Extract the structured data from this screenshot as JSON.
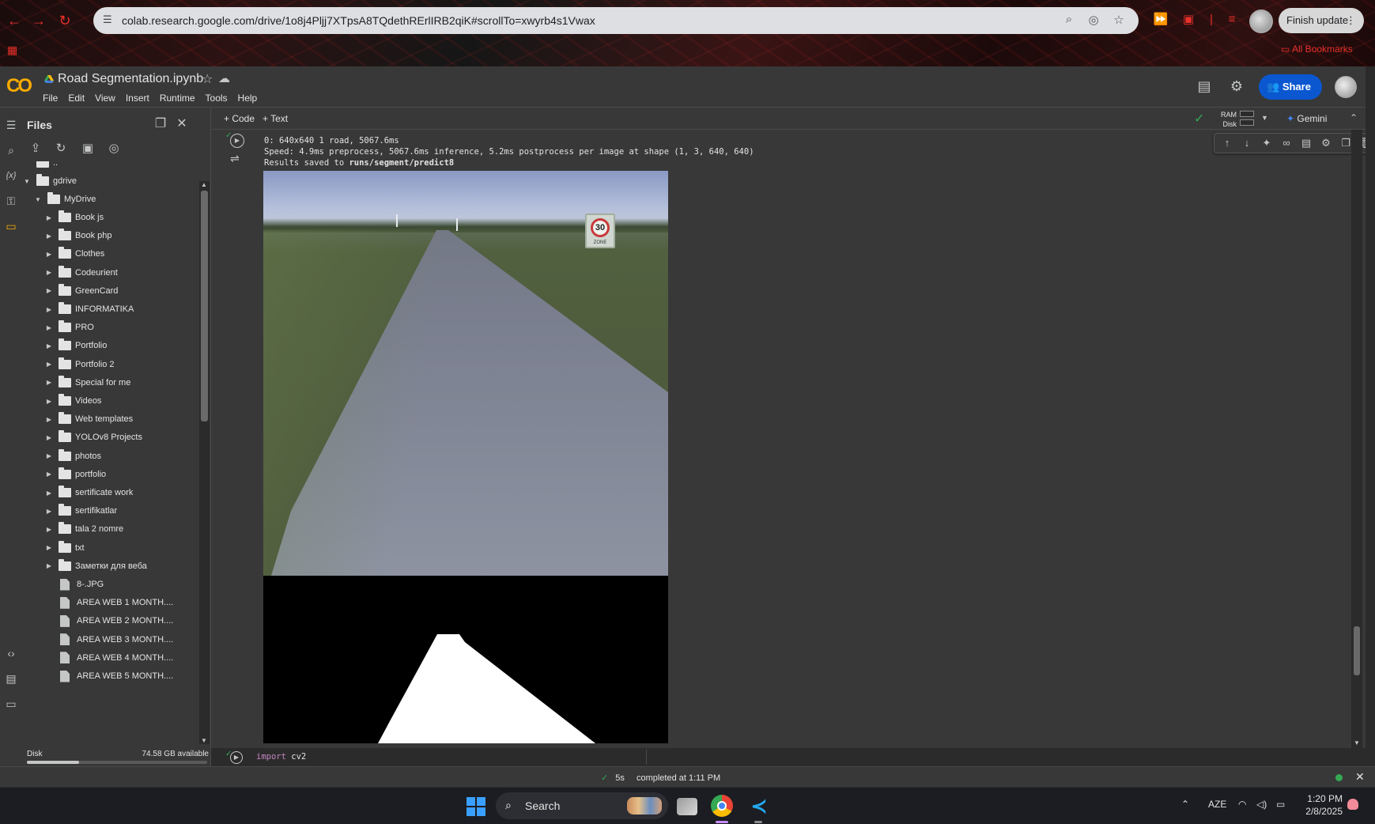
{
  "browser": {
    "url": "colab.research.google.com/drive/1o8j4Pljj7XTpsA8TQdethRErlIRB2qiK#scrollTo=xwyrb4s1Vwax",
    "finish_update_label": "Finish update",
    "all_bookmarks_label": "All Bookmarks",
    "accent_color": "#e8302a"
  },
  "colab": {
    "logo": "CO",
    "notebook_title": "Road Segmentation.ipynb",
    "menu": [
      "File",
      "Edit",
      "View",
      "Insert",
      "Runtime",
      "Tools",
      "Help"
    ],
    "share_label": "Share",
    "toolbar": {
      "add_code": "+ Code",
      "add_text": "+ Text",
      "ram_label": "RAM",
      "disk_label": "Disk",
      "gemini_label": "Gemini"
    }
  },
  "files_panel": {
    "title": "Files",
    "parent_dir": "..",
    "root": "gdrive",
    "mydrive": "MyDrive",
    "folders": [
      "Book js",
      "Book php",
      "Clothes",
      "Codeurient",
      "GreenCard",
      "INFORMATIKA",
      "PRO",
      "Portfolio",
      "Portfolio 2",
      "Special for me",
      "Videos",
      "Web templates",
      "YOLOv8 Projects",
      "photos",
      "portfolio",
      "sertificate work",
      "sertifikatlar",
      "tala 2 nomre",
      "txt",
      "Заметки для веба"
    ],
    "files": [
      "8-.JPG",
      "AREA WEB 1 MONTH....",
      "AREA WEB 2 MONTH....",
      "AREA WEB 3 MONTH....",
      "AREA WEB 4 MONTH....",
      "AREA WEB 5 MONTH...."
    ],
    "disk_label": "Disk",
    "disk_available": "74.58 GB available"
  },
  "cell_output": {
    "line1": "0: 640x640 1 road, 5067.6ms",
    "line2": "Speed: 4.9ms preprocess, 5067.6ms inference, 5.2ms postprocess per image at shape (1, 3, 640, 640)",
    "line3_prefix": "Results saved to ",
    "line3_path": "runs/segment/predict8",
    "sign_value": "30",
    "sign_text": "ZONE"
  },
  "next_cell": {
    "keyword": "import",
    "module": "cv2"
  },
  "status_bar": {
    "check": "✓",
    "duration": "5s",
    "completed": "completed at 1:11 PM"
  },
  "taskbar": {
    "search_label": "Search",
    "language": "AZE",
    "time": "1:20 PM",
    "date": "2/8/2025"
  }
}
